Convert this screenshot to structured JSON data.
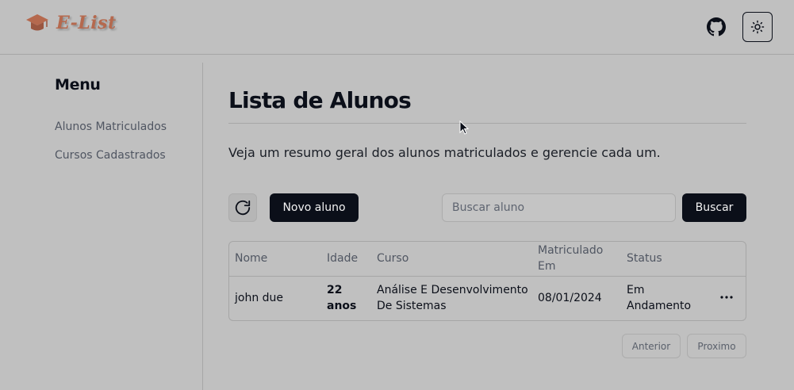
{
  "header": {
    "brand": "E-List",
    "github_icon": "github-icon",
    "theme_icon": "sun-icon"
  },
  "sidebar": {
    "title": "Menu",
    "items": [
      {
        "label": "Alunos Matriculados"
      },
      {
        "label": "Cursos Cadastrados"
      }
    ]
  },
  "main": {
    "title": "Lista de Alunos",
    "subtitle": "Veja um resumo geral dos alunos matriculados e gerencie cada um.",
    "toolbar": {
      "refresh_icon": "refresh-icon",
      "new_label": "Novo aluno",
      "search_placeholder": "Buscar aluno",
      "search_value": "",
      "search_label": "Buscar"
    },
    "table": {
      "columns": [
        "Nome",
        "Idade",
        "Curso",
        "Matriculado Em",
        "Status"
      ],
      "rows": [
        {
          "nome": "john due",
          "idade": "22 anos",
          "curso": "Análise E Desenvolvimento De Sistemas",
          "matriculado": "08/01/2024",
          "status": "Em Andamento"
        }
      ]
    },
    "pagination": {
      "prev": "Anterior",
      "next": "Proximo"
    }
  },
  "colors": {
    "background": "#c0c0c0",
    "primary": "#0b0f19",
    "brand": "#b5694e"
  }
}
